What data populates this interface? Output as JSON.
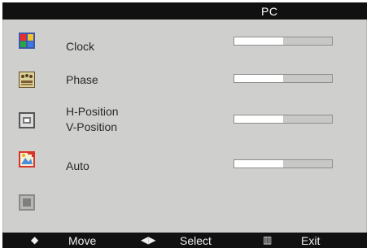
{
  "header": {
    "title": "PC"
  },
  "menu": {
    "items": [
      {
        "icon": "clock-icon",
        "label": "Clock",
        "value": 0.5
      },
      {
        "icon": "phase-icon",
        "label": "Phase",
        "value": 0.5
      },
      {
        "icon": "position-icon",
        "label": "H-Position",
        "label2": "V-Position",
        "value": 0.5
      },
      {
        "icon": "auto-adjust-icon",
        "label": "Auto",
        "value": 0.5
      },
      {
        "icon": "reset-icon"
      }
    ]
  },
  "footer": {
    "move_icon": "◆",
    "move_label": "Move",
    "select_icon": "◀▶",
    "select_label": "Select",
    "exit_icon": "▥",
    "exit_label": "Exit"
  },
  "colors": {
    "panel_background": "#cfcfcd",
    "title_bar": "#111111",
    "bar_fill": "#ffffff",
    "bar_track": "#c8c8c6"
  }
}
